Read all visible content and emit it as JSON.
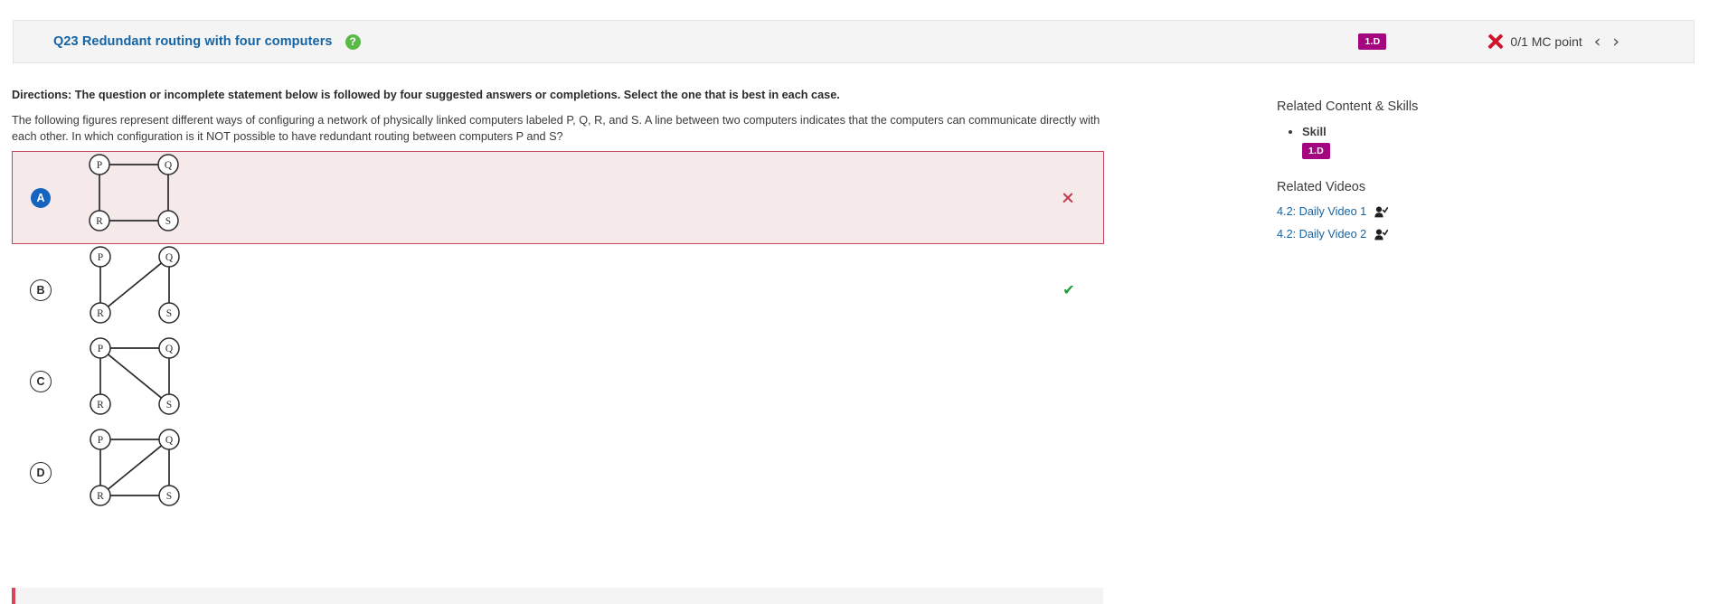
{
  "header": {
    "question_title": "Q23 Redundant routing with four computers",
    "help_icon": "question-mark-icon",
    "skill_tag": "1.D",
    "score_text": "0/1 MC point",
    "score_icon": "x-mark-icon",
    "prev_label": "‹",
    "next_label": "›"
  },
  "question": {
    "directions": "Directions: The question or incomplete statement below is followed by four suggested answers or completions. Select the one that is best in each case.",
    "stem": "The following figures represent different ways of configuring a network of physically linked computers labeled P, Q, R, and S. A line between two computers indicates that the computers can communicate directly with each other. In which configuration is it NOT possible to have redundant routing between computers P and S?"
  },
  "options": [
    {
      "letter": "A",
      "selected": true,
      "mark": "x-mark-icon",
      "nodes": [
        "P",
        "Q",
        "R",
        "S"
      ],
      "edges": [
        "P-Q",
        "P-R",
        "Q-S",
        "R-S"
      ]
    },
    {
      "letter": "B",
      "selected": false,
      "mark": "check-mark-icon",
      "nodes": [
        "P",
        "Q",
        "R",
        "S"
      ],
      "edges": [
        "P-R",
        "Q-R",
        "Q-S"
      ]
    },
    {
      "letter": "C",
      "selected": false,
      "mark": "",
      "nodes": [
        "P",
        "Q",
        "R",
        "S"
      ],
      "edges": [
        "P-Q",
        "P-R",
        "P-S",
        "Q-S"
      ]
    },
    {
      "letter": "D",
      "selected": false,
      "mark": "",
      "nodes": [
        "P",
        "Q",
        "R",
        "S"
      ],
      "edges": [
        "P-Q",
        "P-R",
        "Q-R",
        "Q-S",
        "R-S"
      ]
    }
  ],
  "sidebar": {
    "related_content_heading": "Related Content & Skills",
    "skill_label": "Skill",
    "skill_chip": "1.D",
    "related_videos_heading": "Related Videos",
    "videos": [
      {
        "label": "4.2: Daily Video 1",
        "icon": "person-check-icon"
      },
      {
        "label": "4.2: Daily Video 2",
        "icon": "person-check-icon"
      }
    ]
  },
  "colors": {
    "link_blue": "#1464a5",
    "skill_magenta": "#a4067f",
    "incorrect_red": "#cf142b",
    "correct_green": "#1e9a3c",
    "selected_bg": "#f6e9e9",
    "selected_border": "#c8485b",
    "help_green": "#5bba47"
  }
}
